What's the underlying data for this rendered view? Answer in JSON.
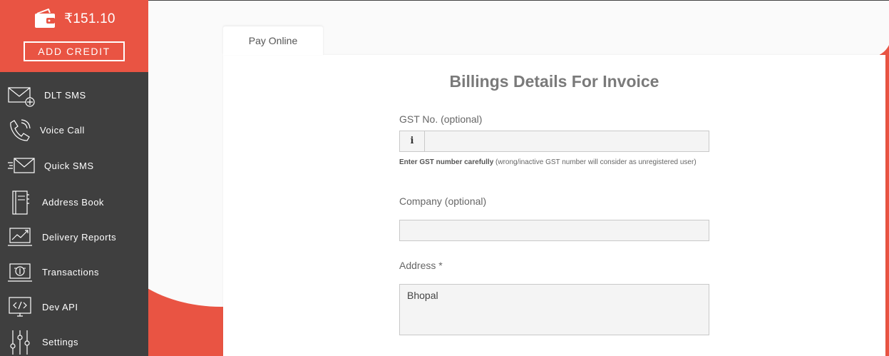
{
  "sidebar": {
    "balance": "₹151.10",
    "add_credit_label": "ADD CREDIT",
    "items": [
      {
        "label": "DLT SMS",
        "icon": "envelope-plus-icon"
      },
      {
        "label": "Voice Call",
        "icon": "phone-icon"
      },
      {
        "label": "Quick SMS",
        "icon": "fast-envelope-icon"
      },
      {
        "label": "Address Book",
        "icon": "address-book-icon"
      },
      {
        "label": "Delivery Reports",
        "icon": "chart-laptop-icon"
      },
      {
        "label": "Transactions",
        "icon": "coin-laptop-icon"
      },
      {
        "label": "Dev API",
        "icon": "code-monitor-icon"
      },
      {
        "label": "Settings",
        "icon": "sliders-icon"
      }
    ]
  },
  "tab": {
    "label": "Pay Online"
  },
  "form": {
    "title": "Billings Details For Invoice",
    "gst_label": "GST No. (optional)",
    "gst_value": "",
    "gst_help_bold": "Enter GST number carefully",
    "gst_help_rest": " (wrong/inactive GST number will consider as unregistered user)",
    "company_label": "Company (optional)",
    "company_value": "",
    "address_label": "Address *",
    "address_value": "Bhopal"
  },
  "colors": {
    "accent": "#e95443",
    "sidebar": "#3f3f3f"
  }
}
